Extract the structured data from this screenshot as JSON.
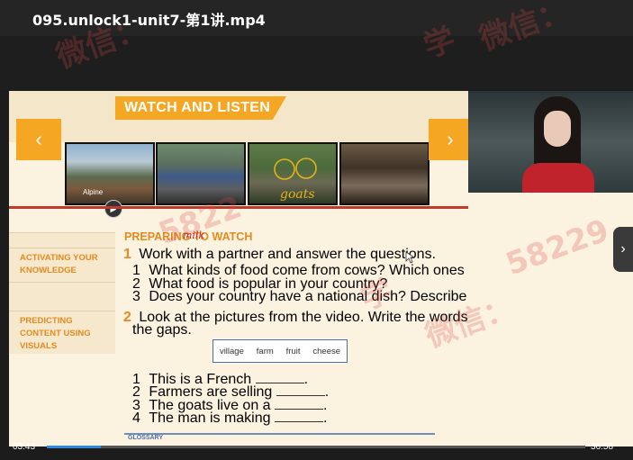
{
  "video_title": "095.unlock1-unit7-第1讲.mp4",
  "slide": {
    "header": "WATCH AND LISTEN",
    "frame_caption": "Alpine",
    "handwriting_goats": "goats",
    "handwriting_milk": "milk",
    "section_title": "PREPARING TO WATCH",
    "tags": [
      {
        "label_1": "ACTIVATING YOUR",
        "label_2": "KNOWLEDGE"
      },
      {
        "label_1": "PREDICTING",
        "label_2": "CONTENT USING",
        "label_3": "VISUALS"
      }
    ],
    "q1": {
      "num": "1",
      "text": "Work with a partner and answer the questions.",
      "items": [
        {
          "num": "1",
          "text": "What kinds of food come from cows? Which ones do you like?"
        },
        {
          "num": "2",
          "text": "What food is popular in your country?"
        },
        {
          "num": "3",
          "text": "Does your country have a national dish? Describe it."
        }
      ]
    },
    "q2": {
      "num": "2",
      "text_1": "Look at the pictures from the video. Write the words from the box in",
      "text_2": "the gaps.",
      "words": [
        "village",
        "farm",
        "fruit",
        "cheese"
      ],
      "items": [
        {
          "num": "1",
          "text": "This is a French",
          "end": "."
        },
        {
          "num": "2",
          "text": "Farmers are selling",
          "end": "."
        },
        {
          "num": "3",
          "text": "The goats live on a",
          "end": "."
        },
        {
          "num": "4",
          "text": "The man is making",
          "end": "."
        }
      ]
    },
    "glossary": "GLOSSARY"
  },
  "player": {
    "current_time": "03:43",
    "total_time": "36:58",
    "progress_fraction": 0.1
  },
  "watermarks": [
    "微信：",
    "学",
    "微信：",
    "5822",
    "学",
    "微信：",
    "58229"
  ]
}
